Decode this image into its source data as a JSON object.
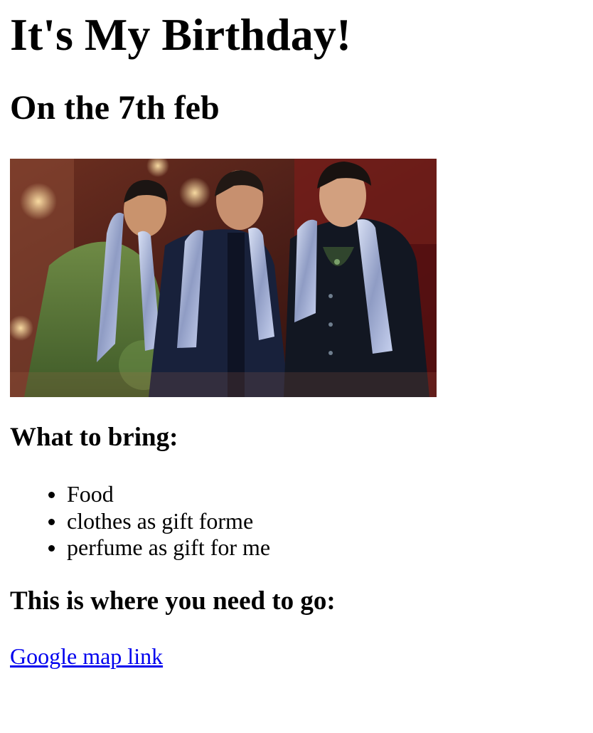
{
  "page": {
    "title": "It's My Birthday!",
    "subtitle": "On the 7th feb",
    "photo": {
      "description_icon": "party-photo",
      "colors": {
        "background_warm": "#6b2418",
        "stage_light": "#f1c27d",
        "green_jacket": "#5d7a3a",
        "navy_suit": "#17203a",
        "black_suit": "#121722",
        "scarf_silver": "#aeb9d8"
      }
    },
    "bring_heading": "What to bring:",
    "bring_items": [
      "Food",
      "clothes as gift forme",
      "perfume as gift for me"
    ],
    "go_heading": "This is where you need to go:",
    "map_link": "Google map link",
    "link_color": "#0000ee"
  }
}
